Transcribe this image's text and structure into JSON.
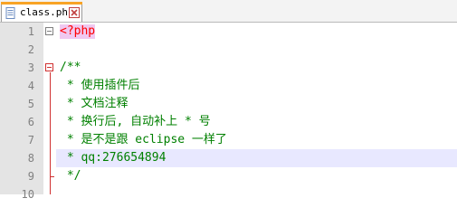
{
  "tab": {
    "title": "class.php",
    "file_icon": "document-icon",
    "close_icon": "close-icon",
    "accent": "#f8a325"
  },
  "editor": {
    "current_line": 8,
    "lines": [
      {
        "number": "1",
        "text": "<?php",
        "kind": "php-tag"
      },
      {
        "number": "2",
        "text": "",
        "kind": "plain"
      },
      {
        "number": "3",
        "text": "/**",
        "kind": "comment"
      },
      {
        "number": "4",
        "text": " * 使用插件后",
        "kind": "comment"
      },
      {
        "number": "5",
        "text": " * 文档注释",
        "kind": "comment"
      },
      {
        "number": "6",
        "text": " * 换行后, 自动补上 * 号",
        "kind": "comment"
      },
      {
        "number": "7",
        "text": " * 是不是跟 eclipse 一样了",
        "kind": "comment"
      },
      {
        "number": "8",
        "text": " * qq:276654894",
        "kind": "comment"
      },
      {
        "number": "9",
        "text": " */",
        "kind": "comment"
      },
      {
        "number": "10",
        "text": "",
        "kind": "plain"
      }
    ]
  },
  "colors": {
    "comment": "#008000",
    "php_tag": "#ff0000",
    "line_number": "#808080",
    "current_line_bg": "#e8e8ff",
    "fold_marker": "#d03030"
  }
}
